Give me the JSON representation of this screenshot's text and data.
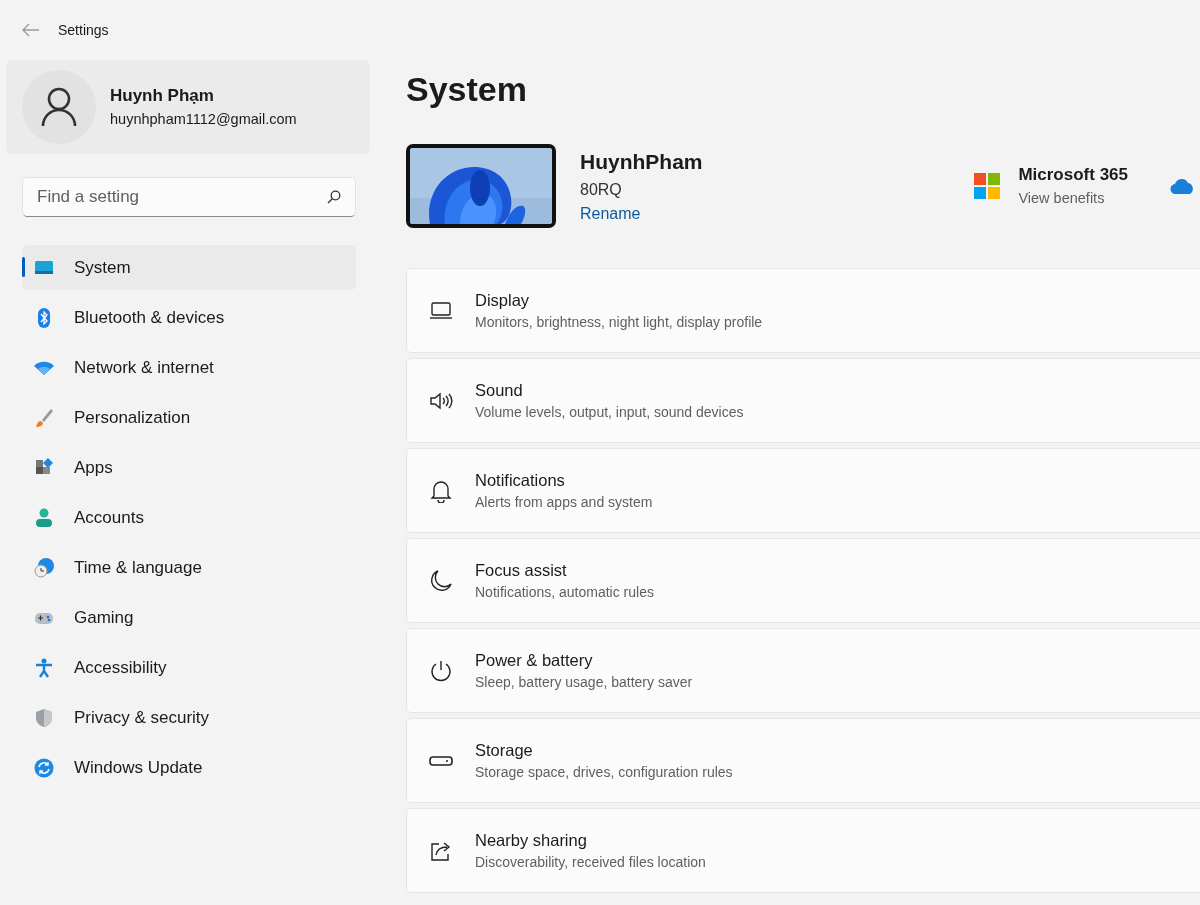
{
  "window": {
    "title": "Settings"
  },
  "account": {
    "name": "Huynh Phạm",
    "email": "huynhpham1112@gmail.com"
  },
  "search": {
    "placeholder": "Find a setting"
  },
  "sidebar": {
    "items": [
      {
        "label": "System",
        "selected": true
      },
      {
        "label": "Bluetooth & devices",
        "selected": false
      },
      {
        "label": "Network & internet",
        "selected": false
      },
      {
        "label": "Personalization",
        "selected": false
      },
      {
        "label": "Apps",
        "selected": false
      },
      {
        "label": "Accounts",
        "selected": false
      },
      {
        "label": "Time & language",
        "selected": false
      },
      {
        "label": "Gaming",
        "selected": false
      },
      {
        "label": "Accessibility",
        "selected": false
      },
      {
        "label": "Privacy & security",
        "selected": false
      },
      {
        "label": "Windows Update",
        "selected": false
      }
    ]
  },
  "page": {
    "title": "System"
  },
  "device": {
    "name": "HuynhPham",
    "model": "80RQ",
    "rename_link": "Rename"
  },
  "promo": {
    "title": "Microsoft 365",
    "subtitle": "View benefits"
  },
  "settings": [
    {
      "title": "Display",
      "subtitle": "Monitors, brightness, night light, display profile"
    },
    {
      "title": "Sound",
      "subtitle": "Volume levels, output, input, sound devices"
    },
    {
      "title": "Notifications",
      "subtitle": "Alerts from apps and system"
    },
    {
      "title": "Focus assist",
      "subtitle": "Notifications, automatic rules"
    },
    {
      "title": "Power & battery",
      "subtitle": "Sleep, battery usage, battery saver"
    },
    {
      "title": "Storage",
      "subtitle": "Storage space, drives, configuration rules"
    },
    {
      "title": "Nearby sharing",
      "subtitle": "Discoverability, received files location"
    }
  ]
}
